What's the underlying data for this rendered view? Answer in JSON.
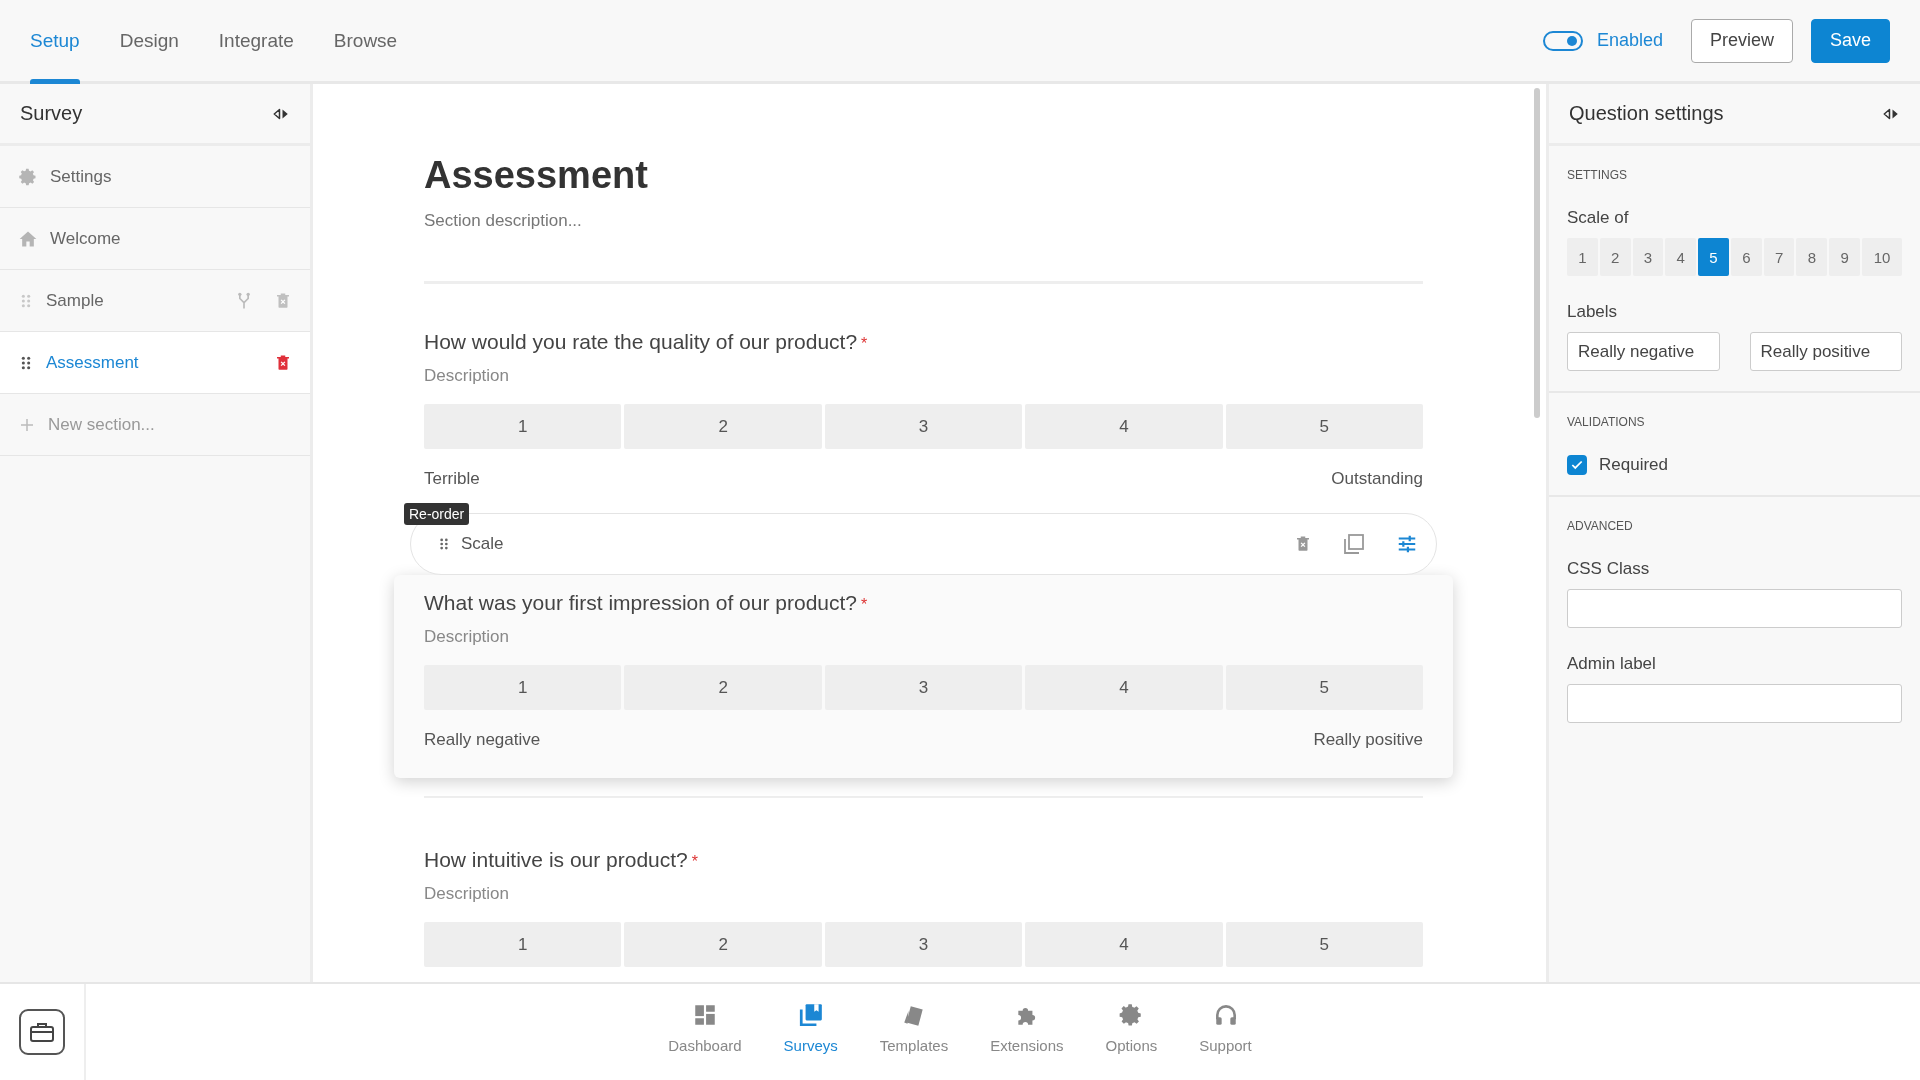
{
  "tabs": [
    {
      "label": "Setup",
      "selected": true
    },
    {
      "label": "Design",
      "selected": false
    },
    {
      "label": "Integrate",
      "selected": false
    },
    {
      "label": "Browse",
      "selected": false
    }
  ],
  "status_toggle": {
    "label": "Enabled",
    "on": true
  },
  "header_buttons": [
    {
      "label": "Preview",
      "kind": "secondary"
    },
    {
      "label": "Save",
      "kind": "primary"
    }
  ],
  "sidebar": {
    "title": "Survey",
    "items": [
      {
        "kind": "settings",
        "label": "Settings",
        "selected": false
      },
      {
        "kind": "welcome",
        "label": "Welcome",
        "selected": false
      },
      {
        "kind": "section",
        "label": "Sample",
        "selected": false,
        "logic": true
      },
      {
        "kind": "section",
        "label": "Assessment",
        "selected": true,
        "logic": false
      },
      {
        "kind": "new",
        "label": "New section..."
      }
    ]
  },
  "section": {
    "title": "Assessment",
    "description": "Section description...",
    "questions": [
      {
        "title": "How would you rate the quality of our product?",
        "required_mark": "*",
        "description": "Description",
        "scale": [
          "1",
          "2",
          "3",
          "4",
          "5"
        ],
        "low_label": "Terrible",
        "high_label": "Outstanding",
        "selected": false
      },
      {
        "title": "What was your first impression of our product?",
        "required_mark": "*",
        "description": "Description",
        "scale": [
          "1",
          "2",
          "3",
          "4",
          "5"
        ],
        "low_label": "Really negative",
        "high_label": "Really positive",
        "selected": true,
        "toolbar": {
          "type_label": "Scale",
          "tooltip": "Re-order"
        }
      },
      {
        "title": "How intuitive is our product?",
        "required_mark": "*",
        "description": "Description",
        "scale": [
          "1",
          "2",
          "3",
          "4",
          "5"
        ],
        "selected": false
      }
    ]
  },
  "question_settings": {
    "title": "Question settings",
    "settings": {
      "heading": "SETTINGS",
      "scale_label": "Scale of",
      "scale_options": [
        {
          "label": "1",
          "selected": false
        },
        {
          "label": "2",
          "selected": false
        },
        {
          "label": "3",
          "selected": false
        },
        {
          "label": "4",
          "selected": false
        },
        {
          "label": "5",
          "selected": true
        },
        {
          "label": "6",
          "selected": false
        },
        {
          "label": "7",
          "selected": false
        },
        {
          "label": "8",
          "selected": false
        },
        {
          "label": "9",
          "selected": false
        },
        {
          "label": "10",
          "selected": false
        }
      ],
      "labels_label": "Labels",
      "label_values": [
        "Really negative",
        "Really positive"
      ]
    },
    "validations": {
      "heading": "VALIDATIONS",
      "required": {
        "label": "Required",
        "checked": true
      }
    },
    "advanced": {
      "heading": "ADVANCED",
      "fields": [
        {
          "label": "CSS Class"
        },
        {
          "label": "Admin label"
        }
      ]
    }
  },
  "bottom_nav": [
    {
      "kind": "dashboard",
      "label": "Dashboard",
      "selected": false
    },
    {
      "kind": "surveys",
      "label": "Surveys",
      "selected": true
    },
    {
      "kind": "templates",
      "label": "Templates",
      "selected": false
    },
    {
      "kind": "extensions",
      "label": "Extensions",
      "selected": false
    },
    {
      "kind": "options",
      "label": "Options",
      "selected": false
    },
    {
      "kind": "support",
      "label": "Support",
      "selected": false
    }
  ]
}
